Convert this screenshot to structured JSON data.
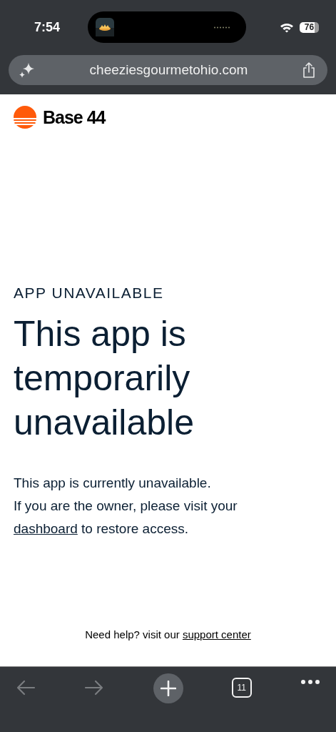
{
  "status_bar": {
    "time": "7:54",
    "battery": "76"
  },
  "address_bar": {
    "url": "cheeziesgourmetohio.com"
  },
  "brand": {
    "name": "Base 44"
  },
  "eyebrow": "APP UNAVAILABLE",
  "heading": "This app is temporarily unavailable",
  "message": {
    "line_1": "This app is currently unavailable.",
    "before_link": "If you are the owner, please visit your",
    "link": "dashboard",
    "after_link": "to restore access."
  },
  "help": {
    "text": "Need help? visit our",
    "link": "support center"
  },
  "toolbar": {
    "back_disabled": true,
    "forward_disabled": true,
    "tab_count": "11"
  }
}
